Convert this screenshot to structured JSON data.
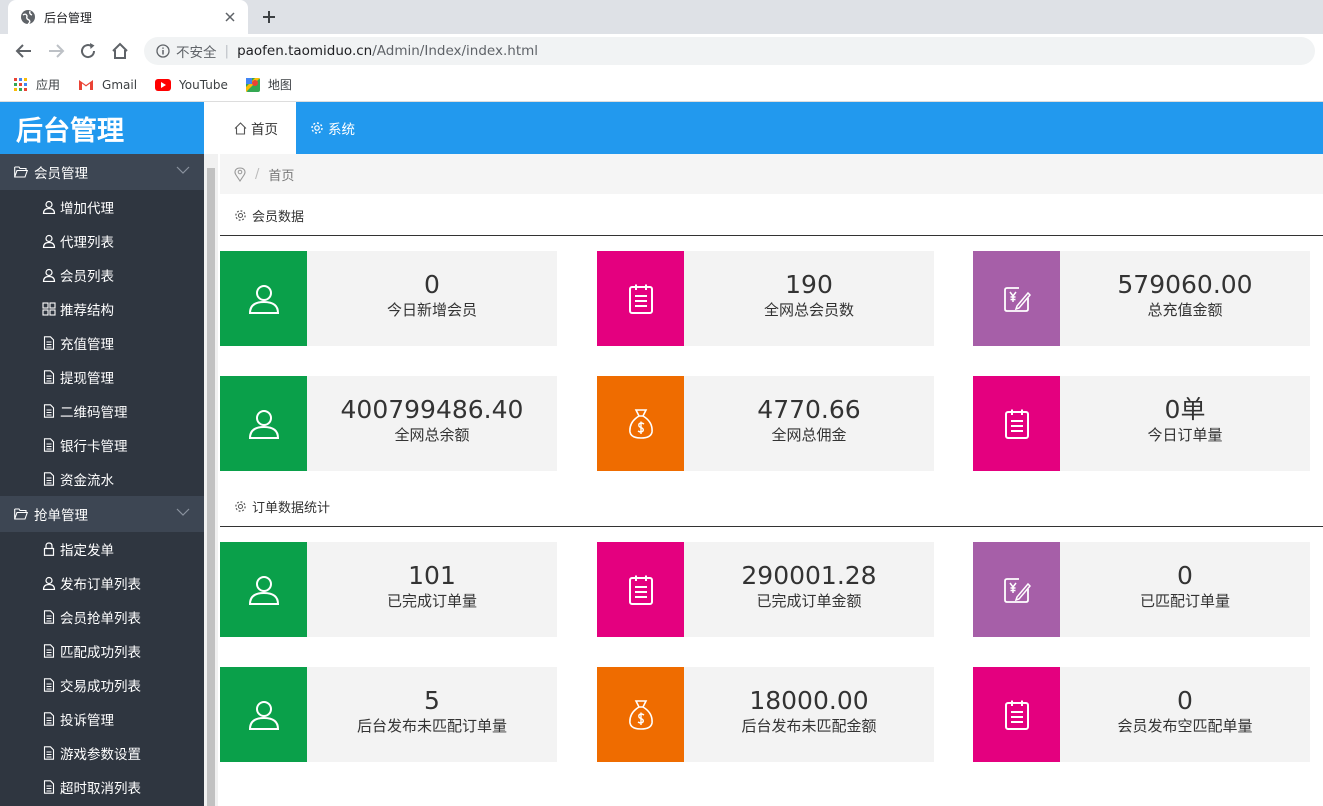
{
  "browser": {
    "tab_title": "后台管理",
    "omnibox": {
      "not_secure": "不安全",
      "separator": "|",
      "domain": "paofen.taomiduo.cn",
      "path": "/Admin/Index/index.html"
    },
    "bookmarks": [
      "应用",
      "Gmail",
      "YouTube",
      "地图"
    ]
  },
  "app": {
    "logo": "后台管理",
    "top_tabs": [
      {
        "label": "首页",
        "icon": "home-icon"
      },
      {
        "label": "系统",
        "icon": "gear-icon"
      }
    ],
    "breadcrumb": {
      "separator": "/",
      "current": "首页"
    }
  },
  "sidebar": {
    "groups": [
      {
        "label": "会员管理",
        "items": [
          {
            "label": "增加代理",
            "icon": "user-icon"
          },
          {
            "label": "代理列表",
            "icon": "user-icon"
          },
          {
            "label": "会员列表",
            "icon": "user-icon"
          },
          {
            "label": "推荐结构",
            "icon": "grid-icon"
          },
          {
            "label": "充值管理",
            "icon": "document-icon"
          },
          {
            "label": "提现管理",
            "icon": "document-icon"
          },
          {
            "label": "二维码管理",
            "icon": "document-icon"
          },
          {
            "label": "银行卡管理",
            "icon": "document-icon"
          },
          {
            "label": "资金流水",
            "icon": "document-icon"
          }
        ]
      },
      {
        "label": "抢单管理",
        "items": [
          {
            "label": "指定发单",
            "icon": "lock-icon"
          },
          {
            "label": "发布订单列表",
            "icon": "user-icon"
          },
          {
            "label": "会员抢单列表",
            "icon": "document-icon"
          },
          {
            "label": "匹配成功列表",
            "icon": "document-icon"
          },
          {
            "label": "交易成功列表",
            "icon": "document-icon"
          },
          {
            "label": "投诉管理",
            "icon": "document-icon"
          },
          {
            "label": "游戏参数设置",
            "icon": "document-icon"
          },
          {
            "label": "超时取消列表",
            "icon": "document-icon"
          }
        ]
      }
    ]
  },
  "sections": {
    "member": {
      "title": "会员数据",
      "cards": [
        {
          "value": "0",
          "label": "今日新增会员",
          "icon": "user-icon",
          "color": "#0aa04a"
        },
        {
          "value": "190",
          "label": "全网总会员数",
          "icon": "clipboard-icon",
          "color": "#e4007f"
        },
        {
          "value": "579060.00",
          "label": "总充值金额",
          "icon": "yen-edit-icon",
          "color": "#a65fa8"
        },
        {
          "value": "400799486.40",
          "label": "全网总余额",
          "icon": "user-icon",
          "color": "#0aa04a"
        },
        {
          "value": "4770.66",
          "label": "全网总佣金",
          "icon": "money-bag-icon",
          "color": "#ef6c00"
        },
        {
          "value": "0单",
          "label": "今日订单量",
          "icon": "clipboard-icon",
          "color": "#e4007f"
        }
      ]
    },
    "order": {
      "title": "订单数据统计",
      "cards": [
        {
          "value": "101",
          "label": "已完成订单量",
          "icon": "user-icon",
          "color": "#0aa04a"
        },
        {
          "value": "290001.28",
          "label": "已完成订单金额",
          "icon": "clipboard-icon",
          "color": "#e4007f"
        },
        {
          "value": "0",
          "label": "已匹配订单量",
          "icon": "yen-edit-icon",
          "color": "#a65fa8"
        },
        {
          "value": "5",
          "label": "后台发布未匹配订单量",
          "icon": "user-icon",
          "color": "#0aa04a"
        },
        {
          "value": "18000.00",
          "label": "后台发布未匹配金额",
          "icon": "money-bag-icon",
          "color": "#ef6c00"
        },
        {
          "value": "0",
          "label": "会员发布空匹配单量",
          "icon": "clipboard-icon",
          "color": "#e4007f"
        }
      ]
    }
  }
}
